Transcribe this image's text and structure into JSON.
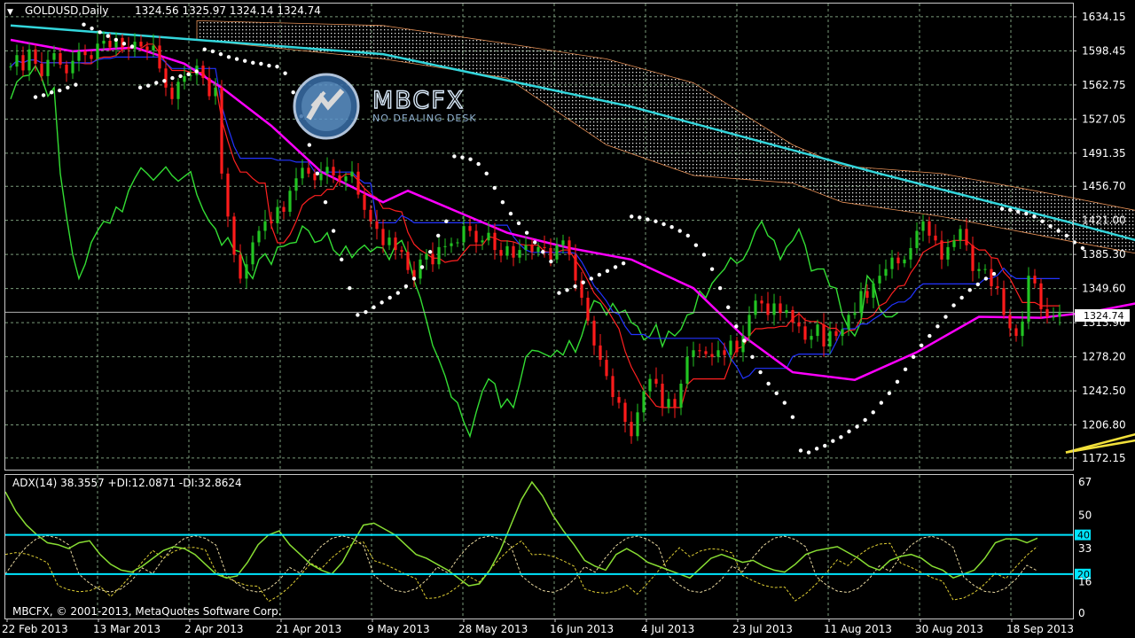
{
  "colors": {
    "background": "#000000",
    "grid": "#7a9a7a",
    "frame": "#c8c8c8",
    "bull": "#22c422",
    "bear": "#ff1b1b",
    "ma_fast": "#ff00ff",
    "ma_slow": "#33d6dc",
    "tenkan": "#ff2020",
    "kijun": "#2233ff",
    "chikou": "#33dd33",
    "sar": "#ffffff",
    "trend": "#f2e03a",
    "cloud": "#ffa060",
    "adx": "#88dd33",
    "di_plus": "#e8d8a0",
    "di_minus": "#ddcc33",
    "level": "#00e5ff"
  },
  "header": {
    "symbol_label": "GOLDUSD,Daily",
    "ohlc_text": "1324.56 1325.97 1324.14 1324.74"
  },
  "watermark": {
    "name": "MBCFX",
    "tagline": "NO DEALING DESK",
    "icon": "mbcfx-logo-icon"
  },
  "indicator": {
    "title": "ADX(14) 38.3557 +DI:12.0871 -DI:32.8624",
    "copyright": "MBCFX, © 2001-2013, MetaQuotes Software Corp."
  },
  "chart_data": {
    "type": "candlestick",
    "symbol": "GOLDUSD",
    "timeframe": "Daily",
    "last": {
      "open": 1324.56,
      "high": 1325.97,
      "low": 1324.14,
      "close": 1324.74
    },
    "current_price_label": "1324.74",
    "price_ylim": [
      1160,
      1648
    ],
    "price_ticks": [
      "1634.15",
      "1598.45",
      "1562.75",
      "1527.05",
      "1491.35",
      "1456.70",
      "1421.00",
      "1385.30",
      "1349.60",
      "1313.90",
      "1278.20",
      "1242.50",
      "1206.80",
      "1172.15"
    ],
    "x_labels": [
      "22 Feb 2013",
      "13 Mar 2013",
      "2 Apr 2013",
      "21 Apr 2013",
      "9 May 2013",
      "28 May 2013",
      "16 Jun 2013",
      "4 Jul 2013",
      "23 Jul 2013",
      "11 Aug 2013",
      "30 Aug 2013",
      "18 Sep 2013"
    ],
    "closes": [
      1582,
      1594,
      1578,
      1600,
      1585,
      1572,
      1589,
      1596,
      1584,
      1575,
      1588,
      1598,
      1594,
      1590,
      1606,
      1609,
      1602,
      1612,
      1602,
      1600,
      1608,
      1603,
      1599,
      1604,
      1580,
      1560,
      1548,
      1566,
      1572,
      1573,
      1583,
      1570,
      1551,
      1560,
      1470,
      1425,
      1385,
      1360,
      1375,
      1398,
      1410,
      1420,
      1418,
      1435,
      1430,
      1452,
      1465,
      1476,
      1470,
      1463,
      1470,
      1477,
      1468,
      1462,
      1467,
      1472,
      1448,
      1432,
      1420,
      1412,
      1395,
      1403,
      1390,
      1388,
      1369,
      1360,
      1380,
      1386,
      1375,
      1393,
      1394,
      1397,
      1398,
      1415,
      1410,
      1398,
      1400,
      1408,
      1390,
      1384,
      1394,
      1382,
      1390,
      1395,
      1388,
      1393,
      1392,
      1380,
      1395,
      1400,
      1385,
      1358,
      1340,
      1316,
      1290,
      1275,
      1258,
      1236,
      1230,
      1210,
      1195,
      1220,
      1242,
      1255,
      1250,
      1225,
      1234,
      1225,
      1250,
      1278,
      1285,
      1284,
      1281,
      1278,
      1285,
      1280,
      1295,
      1283,
      1300,
      1322,
      1337,
      1334,
      1322,
      1334,
      1324,
      1327,
      1314,
      1310,
      1296,
      1300,
      1312,
      1289,
      1305,
      1300,
      1307,
      1322,
      1324,
      1347,
      1340,
      1355,
      1363,
      1370,
      1382,
      1376,
      1380,
      1392,
      1410,
      1420,
      1405,
      1400,
      1380,
      1393,
      1400,
      1412,
      1395,
      1368,
      1370,
      1370,
      1352,
      1350,
      1322,
      1308,
      1300,
      1315,
      1363,
      1355,
      1328,
      1320,
      1320,
      1324.74
    ],
    "sar_dots": [
      1550,
      1552,
      1555,
      1557,
      1560,
      1563,
      1626,
      1622,
      1618,
      1614,
      1610,
      1606,
      1603,
      1560,
      1562,
      1565,
      1567,
      1570,
      1572,
      1574,
      1577,
      1600,
      1598,
      1595,
      1592,
      1590,
      1588,
      1586,
      1585,
      1583,
      1582,
      1575,
      1555,
      1530,
      1500,
      1470,
      1440,
      1410,
      1380,
      1350,
      1322,
      1325,
      1330,
      1335,
      1340,
      1345,
      1352,
      1360,
      1372,
      1388,
      1405,
      1420,
      1488,
      1487,
      1485,
      1480,
      1470,
      1455,
      1440,
      1428,
      1418,
      1408,
      1398,
      1388,
      1378,
      1345,
      1348,
      1352,
      1356,
      1360,
      1364,
      1368,
      1372,
      1376,
      1425,
      1424,
      1422,
      1420,
      1417,
      1414,
      1410,
      1405,
      1395,
      1385,
      1370,
      1350,
      1330,
      1310,
      1295,
      1278,
      1262,
      1250,
      1240,
      1230,
      1215,
      1180,
      1178,
      1182,
      1185,
      1190,
      1194,
      1200,
      1205,
      1212,
      1220,
      1230,
      1240,
      1252,
      1265,
      1278,
      1290,
      1300,
      1310,
      1320,
      1332,
      1340,
      1348,
      1354,
      1360,
      1365,
      1433,
      1432,
      1430,
      1428,
      1425,
      1420,
      1415,
      1410,
      1405,
      1398,
      1392
    ],
    "sar_x_index_start": 4,
    "sar_x_step": 1,
    "ma_fast_points": [
      [
        0,
        1610
      ],
      [
        10,
        1598
      ],
      [
        20,
        1602
      ],
      [
        28,
        1585
      ],
      [
        34,
        1560
      ],
      [
        42,
        1520
      ],
      [
        50,
        1472
      ],
      [
        60,
        1440
      ],
      [
        64,
        1452
      ],
      [
        72,
        1430
      ],
      [
        80,
        1408
      ],
      [
        90,
        1392
      ],
      [
        100,
        1380
      ],
      [
        110,
        1350
      ],
      [
        118,
        1300
      ],
      [
        126,
        1262
      ],
      [
        136,
        1254
      ],
      [
        146,
        1283
      ],
      [
        156,
        1320
      ],
      [
        166,
        1319
      ],
      [
        174,
        1325
      ],
      [
        186,
        1340
      ],
      [
        196,
        1370
      ],
      [
        204,
        1390
      ],
      [
        214,
        1380
      ],
      [
        222,
        1360
      ],
      [
        226,
        1350
      ]
    ],
    "ma_slow_points": [
      [
        0,
        1625
      ],
      [
        60,
        1595
      ],
      [
        100,
        1540
      ],
      [
        140,
        1470
      ],
      [
        170,
        1420
      ],
      [
        190,
        1385
      ],
      [
        202,
        1368
      ],
      [
        222,
        1357
      ],
      [
        240,
        1352
      ],
      [
        264,
        1340
      ],
      [
        288,
        1330
      ]
    ],
    "trendlines": [
      {
        "from": [
          170,
          1178
        ],
        "to": [
          286,
          1308
        ]
      },
      {
        "from": [
          170,
          1178
        ],
        "to": [
          288,
          1378
        ]
      }
    ],
    "adx": {
      "period": 14,
      "value": 38.3557,
      "plus_di": 12.0871,
      "minus_di": 32.8624,
      "ylim": [
        0,
        67
      ],
      "ticks": [
        "67",
        "50",
        "33",
        "16",
        "0"
      ],
      "levels": [
        40,
        20
      ],
      "level_labels": [
        "40",
        "20"
      ],
      "adx_series": [
        62,
        52,
        45,
        40,
        36,
        35,
        33,
        36,
        37,
        30,
        25,
        22,
        21,
        24,
        28,
        32,
        34,
        33,
        30,
        25,
        20,
        18,
        19,
        26,
        35,
        40,
        42,
        35,
        30,
        25,
        22,
        20,
        26,
        36,
        45,
        46,
        43,
        40,
        35,
        30,
        28,
        25,
        22,
        18,
        14,
        15,
        22,
        32,
        45,
        58,
        67,
        60,
        50,
        42,
        35,
        27,
        24,
        22,
        30,
        33,
        30,
        26,
        24,
        22,
        20,
        18,
        23,
        28,
        30,
        28,
        26,
        27,
        24,
        22,
        21,
        25,
        30,
        32,
        33,
        34,
        31,
        28,
        24,
        22,
        27,
        29,
        30,
        28,
        24,
        22,
        18,
        20,
        22,
        28,
        36,
        38,
        38,
        36,
        38.36
      ]
    }
  }
}
